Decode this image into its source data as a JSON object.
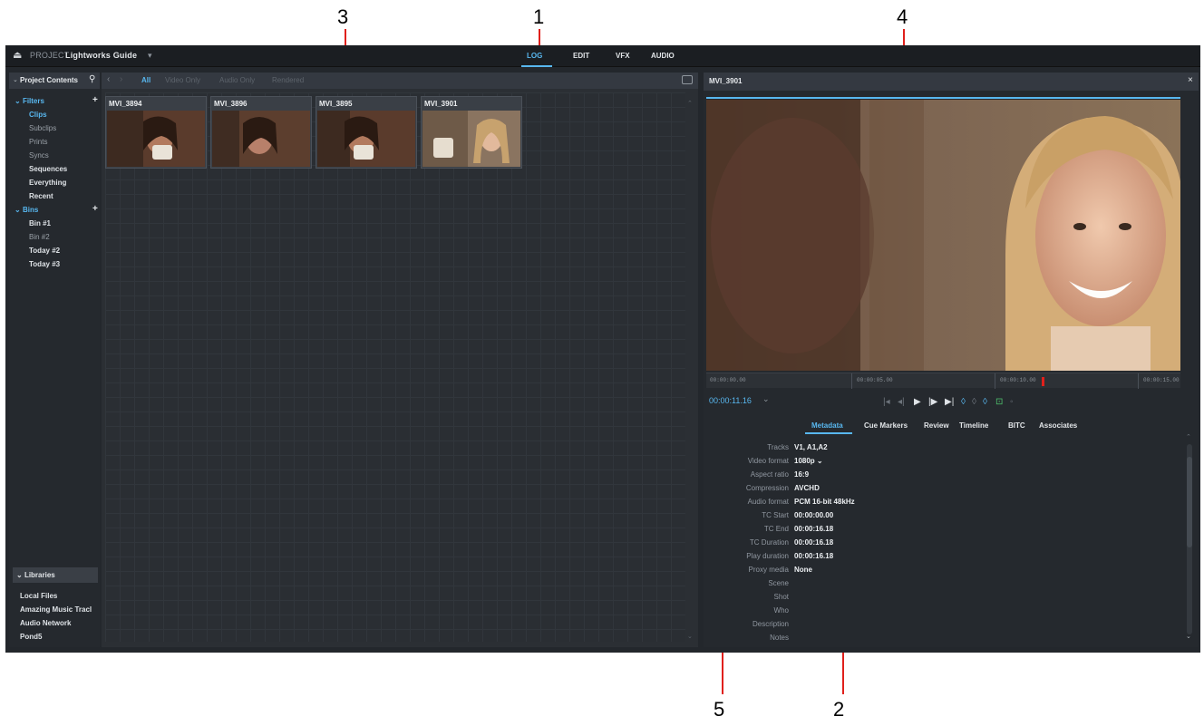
{
  "callouts": [
    "1",
    "2",
    "3",
    "4",
    "5"
  ],
  "topbar": {
    "project_prefix": "PROJECT",
    "project_name": "Lightworks Guide",
    "dropdown_arrow": "▾",
    "room_tabs": [
      "LOG",
      "EDIT",
      "VFX",
      "AUDIO"
    ]
  },
  "sidebar": {
    "header": "Project Contents",
    "filters_label": "Filters",
    "filters": [
      "Clips",
      "Subclips",
      "Prints",
      "Syncs",
      "Sequences",
      "Everything",
      "Recent"
    ],
    "bins_label": "Bins",
    "bins": [
      "Bin #1",
      "Bin #2",
      "Today #2",
      "Today #3"
    ],
    "libraries_label": "Libraries",
    "libraries": [
      "Local Files",
      "Amazing Music Tracl",
      "Audio Network",
      "Pond5"
    ]
  },
  "browser": {
    "filter_tabs": [
      "All",
      "Video Only",
      "Audio Only",
      "Rendered"
    ],
    "clips": [
      "MVI_3894",
      "MVI_3896",
      "MVI_3895",
      "MVI_3901"
    ]
  },
  "viewer": {
    "title": "MVI_3901",
    "close": "×",
    "ruler": [
      "00:00:00.00",
      "00:00:05.00",
      "00:00:10.00",
      "00:00:15.00"
    ],
    "timecode": "00:00:11.16",
    "timecode_arrow": "⌄",
    "tabs": [
      "Metadata",
      "Cue Markers",
      "Review",
      "Timeline",
      "BITC",
      "Associates"
    ],
    "metadata": [
      {
        "key": "Tracks",
        "value": "V1, A1,A2"
      },
      {
        "key": "Video format",
        "value": "1080p ⌄"
      },
      {
        "key": "Aspect ratio",
        "value": "16:9"
      },
      {
        "key": "Compression",
        "value": "AVCHD"
      },
      {
        "key": "Audio format",
        "value": "PCM 16-bit 48kHz"
      },
      {
        "key": "TC Start",
        "value": "00:00:00.00"
      },
      {
        "key": "TC End",
        "value": "00:00:16.18"
      },
      {
        "key": "TC Duration",
        "value": "00:00:16.18"
      },
      {
        "key": "Play duration",
        "value": "00:00:16.18"
      },
      {
        "key": "Proxy media",
        "value": "None"
      },
      {
        "key": "Scene",
        "value": ""
      },
      {
        "key": "Shot",
        "value": ""
      },
      {
        "key": "Who",
        "value": ""
      },
      {
        "key": "Description",
        "value": ""
      },
      {
        "key": "Notes",
        "value": ""
      }
    ]
  },
  "colors": {
    "accent": "#58b7ef",
    "callout_line": "#e0201c",
    "playhead": "#e0201c"
  }
}
